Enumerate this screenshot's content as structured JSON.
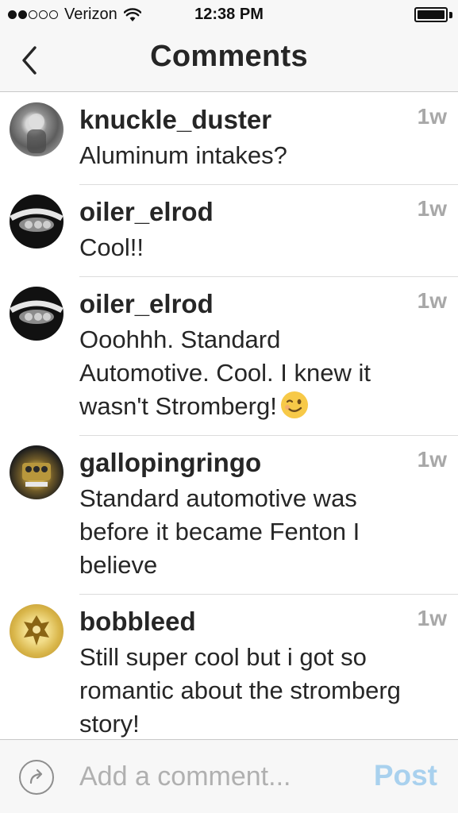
{
  "status_bar": {
    "carrier": "Verizon",
    "time": "12:38 PM",
    "signal_bars": 2,
    "signal_total": 5
  },
  "nav": {
    "title": "Comments",
    "back_icon": "chevron-left-icon"
  },
  "comments": [
    {
      "username": "knuckle_duster",
      "text": "Aluminum intakes?",
      "time": "1w"
    },
    {
      "username": "oiler_elrod",
      "text": "Cool!!",
      "time": "1w"
    },
    {
      "username": "oiler_elrod",
      "text": "Ooohhh. Standard Automotive. Cool. I knew it wasn't Stromberg!",
      "time": "1w",
      "emoji": "winking-face"
    },
    {
      "username": "gallopingringo",
      "text": "Standard automotive was before it became Fenton I believe",
      "time": "1w"
    },
    {
      "username": "bobbleed",
      "text": "Still super cool but i got so romantic  about the stromberg story!",
      "time": "1w"
    }
  ],
  "composer": {
    "placeholder": "Add a comment...",
    "post_label": "Post",
    "post_color": "#a9d1ee"
  },
  "colors": {
    "bar_background": "#f7f7f7",
    "timestamp": "#a8a8a8",
    "text": "#262626"
  }
}
